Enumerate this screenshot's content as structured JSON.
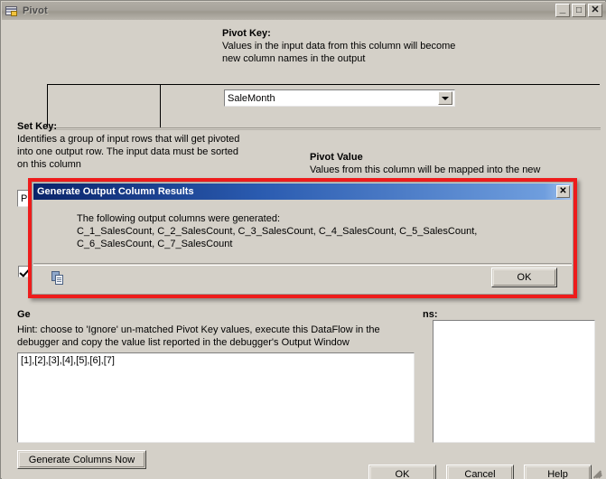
{
  "window": {
    "title": "Pivot",
    "icon": "pivot-grid-icon",
    "controls": {
      "minimize": "_",
      "maximize": "□",
      "close": "✕"
    }
  },
  "pivot_key": {
    "heading": "Pivot Key:",
    "desc_line1": "Values in the input data from this column will become",
    "desc_line2": "new column names in the output",
    "combo_value": "SaleMonth"
  },
  "set_key": {
    "heading": "Set Key:",
    "desc_line1": "Identifies a group of input rows that will get pivoted",
    "desc_line2": "into one output row. The input data must be sorted",
    "desc_line3": "on this column",
    "combo_value": "ProductId"
  },
  "pivot_value": {
    "heading": "Pivot Value",
    "desc_line1": "Values from this column will be mapped into the new"
  },
  "options": {
    "checkbox_checked": true,
    "checkbox_label": ""
  },
  "generate_section": {
    "label": "Ge",
    "right_label": "ns:",
    "hint_line1": "Hint: choose to 'Ignore' un-matched Pivot Key values, execute this DataFlow in the",
    "hint_line2": "debugger and copy the value list reported in the debugger's Output Window",
    "value_list": "[1],[2],[3],[4],[5],[6],[7]",
    "generate_button": "Generate Columns Now"
  },
  "footer": {
    "ok": "OK",
    "cancel": "Cancel",
    "help": "Help"
  },
  "modal": {
    "title": "Generate Output Column Results",
    "close_glyph": "✕",
    "message": "The following output columns were generated:\nC_1_SalesCount, C_2_SalesCount, C_3_SalesCount, C_4_SalesCount, C_5_SalesCount,\nC_6_SalesCount, C_7_SalesCount",
    "copy_icon": "copy-icon",
    "ok_button": "OK",
    "border_color": "#ee1c1c",
    "titlebar_color": "#0a246a"
  }
}
